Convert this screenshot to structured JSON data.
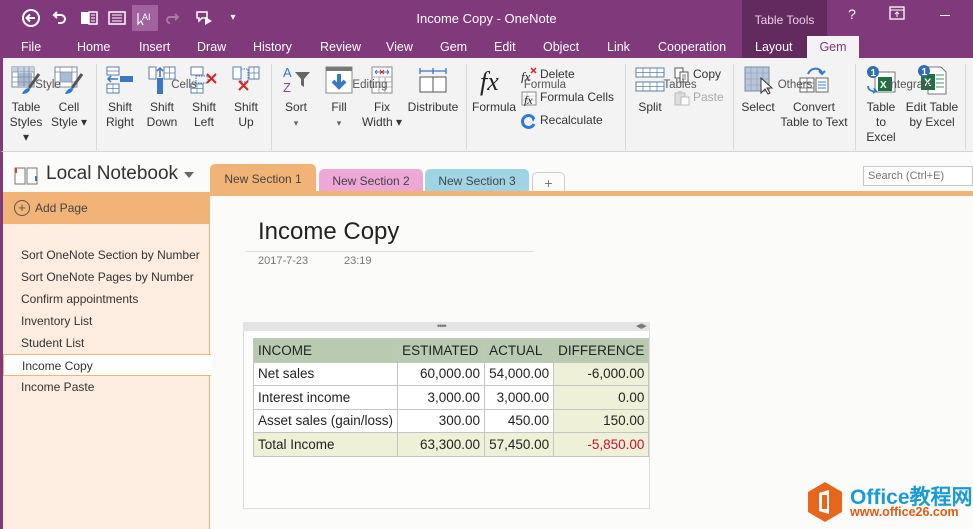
{
  "titlebar": {
    "title": "Income Copy - OneNote",
    "contextual_group": "Table Tools",
    "help": "?",
    "quick_access": [
      {
        "name": "back",
        "glyph": "⮌"
      },
      {
        "name": "undo",
        "glyph": "↶"
      },
      {
        "name": "dock",
        "glyph": "▐"
      },
      {
        "name": "full-page",
        "glyph": "▤"
      },
      {
        "name": "touch-mouse",
        "glyph": "A"
      },
      {
        "name": "redo",
        "glyph": "↷"
      },
      {
        "name": "send",
        "glyph": "▶"
      },
      {
        "name": "customize",
        "glyph": "▾"
      }
    ]
  },
  "ribbon_tabs": [
    "File",
    "Home",
    "Insert",
    "Draw",
    "History",
    "Review",
    "View",
    "Gem",
    "Edit",
    "Object",
    "Link",
    "Cooperation",
    "Layout",
    "Gem"
  ],
  "active_tab": "Gem",
  "ribbon": {
    "groups": {
      "style": "Style",
      "cells": "Cells",
      "editing": "Editing",
      "formula": "Formula",
      "tables": "Tables",
      "others": "Others",
      "integrate": "Integrate"
    },
    "buttons": {
      "table_styles": [
        "Table",
        "Styles ▾"
      ],
      "cell_style": [
        "Cell",
        "Style ▾"
      ],
      "shift_right": [
        "Shift",
        "Right"
      ],
      "shift_down": [
        "Shift",
        "Down"
      ],
      "shift_left": [
        "Shift",
        "Left"
      ],
      "shift_up": [
        "Shift",
        "Up"
      ],
      "sort": [
        "Sort",
        "▾"
      ],
      "fill": [
        "Fill",
        "▾"
      ],
      "fix_width": [
        "Fix",
        "Width ▾"
      ],
      "distribute": "Distribute",
      "formula": "Formula",
      "delete": "Delete",
      "formula_cells": "Formula Cells",
      "recalculate": "Recalculate",
      "split": "Split",
      "copy": "Copy",
      "paste": "Paste",
      "select": "Select",
      "convert": [
        "Convert",
        "Table to Text"
      ],
      "table_to_excel": [
        "Table",
        "to Excel"
      ],
      "edit_table_by_excel": [
        "Edit Table",
        "by Excel"
      ]
    }
  },
  "notebook": {
    "name": "Local Notebook",
    "sections": [
      {
        "label": "New Section 1",
        "color": "#f1b476"
      },
      {
        "label": "New Section 2",
        "color": "#eea8d6"
      },
      {
        "label": "New Section 3",
        "color": "#9fd4e4"
      }
    ],
    "add_section": "+",
    "search_placeholder": "Search (Ctrl+E)"
  },
  "sidebar": {
    "add_page": "Add Page",
    "pages": [
      "Sort OneNote Section by Number",
      "Sort OneNote Pages by Number",
      "Confirm appointments",
      "Inventory List",
      "Student List",
      "Income Copy",
      "Income Paste"
    ],
    "selected_index": 5
  },
  "page": {
    "title": "Income Copy",
    "date": "2017-7-23",
    "time": "23:19",
    "table": {
      "headers": [
        "INCOME",
        "ESTIMATED",
        "ACTUAL",
        "DIFFERENCE"
      ],
      "rows": [
        [
          "Net sales",
          "60,000.00",
          "54,000.00",
          "-6,000.00"
        ],
        [
          "Interest income",
          "3,000.00",
          "3,000.00",
          "0.00"
        ],
        [
          "Asset sales (gain/loss)",
          "300.00",
          "450.00",
          "150.00"
        ],
        [
          "Total Income",
          "63,300.00",
          "57,450.00",
          "-5,850.00"
        ]
      ]
    }
  },
  "watermark": {
    "line1": "Office教程网",
    "line2": "www.office26.com"
  }
}
